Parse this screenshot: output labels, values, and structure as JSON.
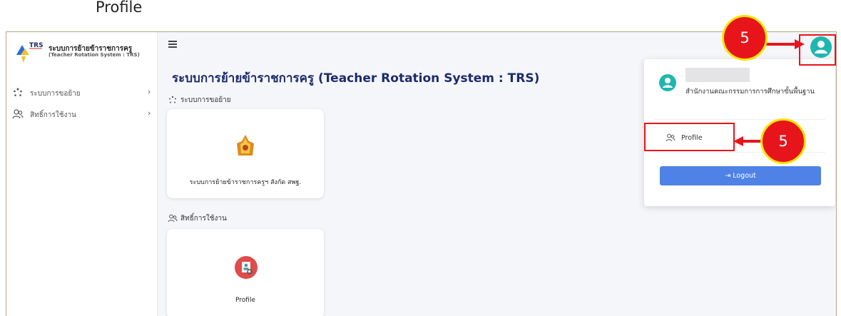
{
  "doc_heading": "Profile",
  "sidebar": {
    "brand_short": "TRS",
    "brand_name": "ระบบการย้ายข้าราชการครู",
    "brand_sub": "(Teacher Rotation System : TRS)",
    "items": [
      {
        "label": "ระบบการขอย้าย",
        "icon": "spinner-icon"
      },
      {
        "label": "สิทธิ์การใช้งาน",
        "icon": "users-icon"
      }
    ]
  },
  "main": {
    "title": "ระบบการย้ายข้าราชการครู (Teacher Rotation System : TRS)",
    "sections": [
      {
        "title": "ระบบการขอย้าย",
        "card_label": "ระบบการย้ายข้าราชการครูฯ สังกัด สพฐ."
      },
      {
        "title": "สิทธิ์การใช้งาน",
        "card_label": "Profile"
      }
    ]
  },
  "dropdown": {
    "org": "สำนักงานคณะกรรมการการศึกษาขั้นพื้นฐาน",
    "profile_label": "Profile",
    "logout_label": "Logout"
  },
  "annotations": {
    "badge_top": "5",
    "badge_profile": "5"
  },
  "colors": {
    "accent_blue": "#4f82e6",
    "teal": "#1eb7b0",
    "title_navy": "#1d2a6b",
    "annotation_red": "#e8141c",
    "annotation_yellow": "#f4e400"
  }
}
